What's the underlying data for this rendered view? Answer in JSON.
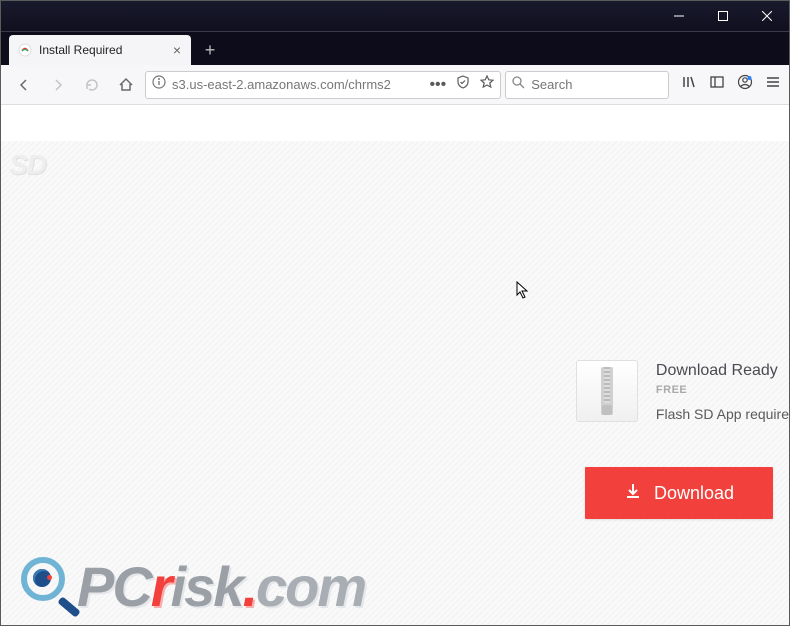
{
  "window": {
    "title": "Install Required"
  },
  "tab": {
    "title": "Install Required"
  },
  "toolbar": {
    "url": "s3.us-east-2.amazonaws.com/chrms2",
    "search_placeholder": "Search"
  },
  "page": {
    "sd_badge": "SD",
    "ad": {
      "title": "Download Ready",
      "badge": "FREE",
      "subtitle": "Flash SD App require"
    },
    "download_button": "Download",
    "watermark": {
      "pc": "PC",
      "r": "r",
      "isk": "isk",
      "dot": ".",
      "com": "com"
    }
  },
  "colors": {
    "accent_red": "#f2403c",
    "chrome_dark": "#0c0c1a"
  }
}
